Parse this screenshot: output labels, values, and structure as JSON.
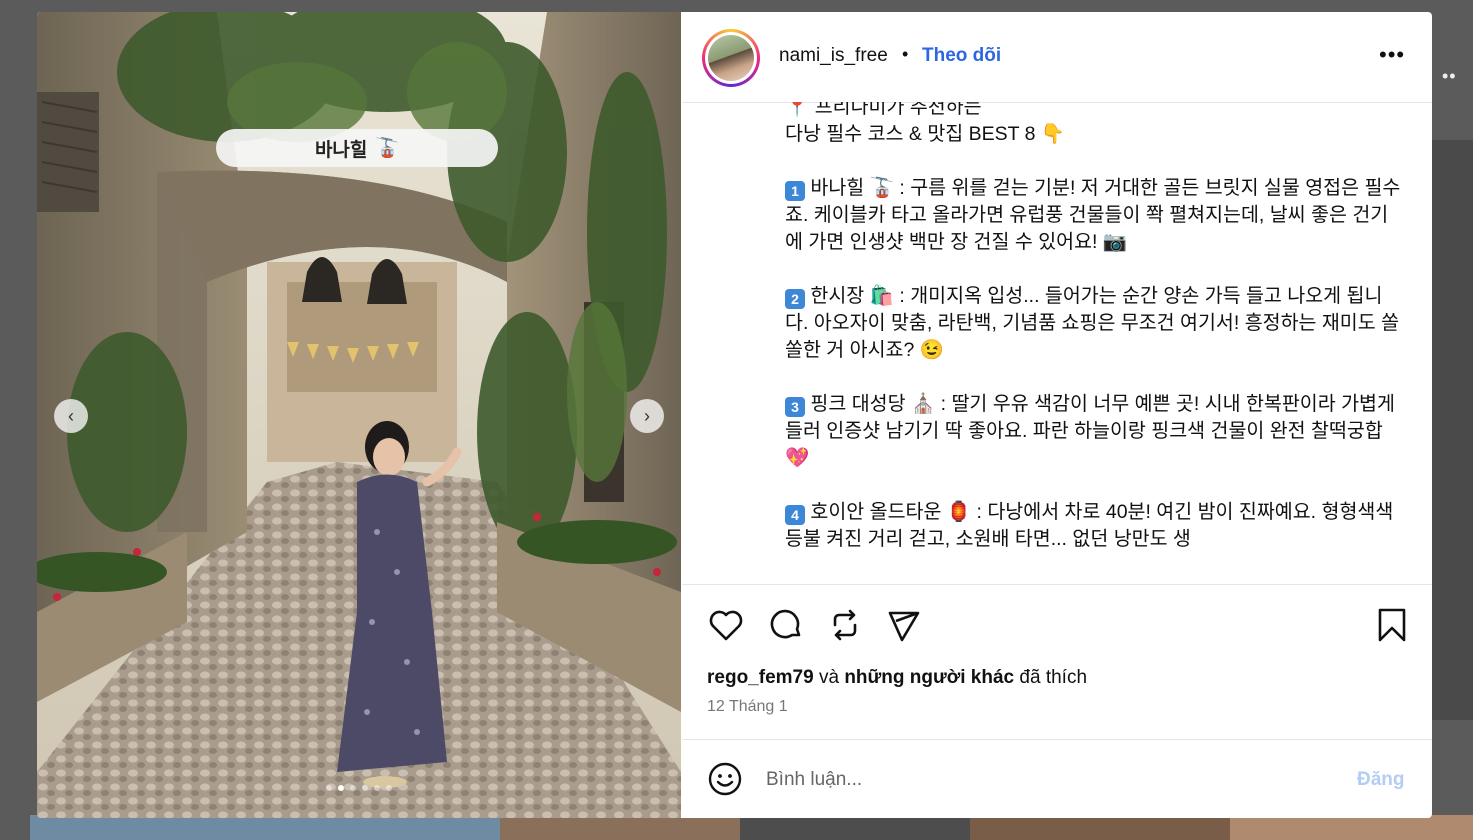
{
  "post": {
    "username": "nami_is_free",
    "separator": "•",
    "follow_label": "Theo dõi",
    "more_label": "•••",
    "image_caption": "바나힐",
    "image_caption_emoji": "🚡",
    "carousel_count": 6,
    "carousel_active_index": 1
  },
  "caption": {
    "intro_line1": "📍 프리나미가 추천하는",
    "intro_line2": "다낭 필수 코스 & 맛집 BEST 8 👇",
    "item1_num": "1",
    "item1": "바나힐 🚡 : 구름 위를 걷는 기분! 저 거대한 골든 브릿지 실물 영접은 필수죠. 케이블카 타고 올라가면 유럽풍 건물들이 쫙 펼쳐지는데, 날씨 좋은 건기에 가면 인생샷 백만 장 건질 수 있어요! 📷",
    "item2_num": "2",
    "item2": "한시장 🛍️ : 개미지옥 입성... 들어가는 순간 양손 가득 들고 나오게 됩니다. 아오자이 맞춤, 라탄백, 기념품 쇼핑은 무조건 여기서! 흥정하는 재미도 쏠쏠한 거 아시죠? 😉",
    "item3_num": "3",
    "item3": "핑크 대성당 ⛪ : 딸기 우유 색감이 너무 예쁜 곳! 시내 한복판이라 가볍게 들러 인증샷 남기기 딱 좋아요. 파란 하늘이랑 핑크색 건물이 완전 찰떡궁합 💖",
    "item4_num": "4",
    "item4": "호이안 올드타운 🏮 : 다낭에서 차로 40분! 여긴 밤이 진짜예요. 형형색색 등불 켜진 거리 걷고, 소원배 타면... 없던 낭만도 생"
  },
  "likes": {
    "user": "rego_fem79",
    "conj": "và",
    "others": "những người khác",
    "suffix": "đã thích"
  },
  "date": "12 Tháng 1",
  "comment": {
    "placeholder": "Bình luận...",
    "post_label": "Đăng"
  },
  "icons": {
    "like": "heart-icon",
    "comment": "comment-icon",
    "share": "repost-icon",
    "send": "send-icon",
    "save": "bookmark-icon",
    "emoji": "smiley-icon",
    "prev": "chevron-left-icon",
    "next": "chevron-right-icon"
  },
  "colors": {
    "follow": "#2c67e0",
    "post_disabled": "#b3cdf5",
    "number_badge": "#3c88d6"
  }
}
